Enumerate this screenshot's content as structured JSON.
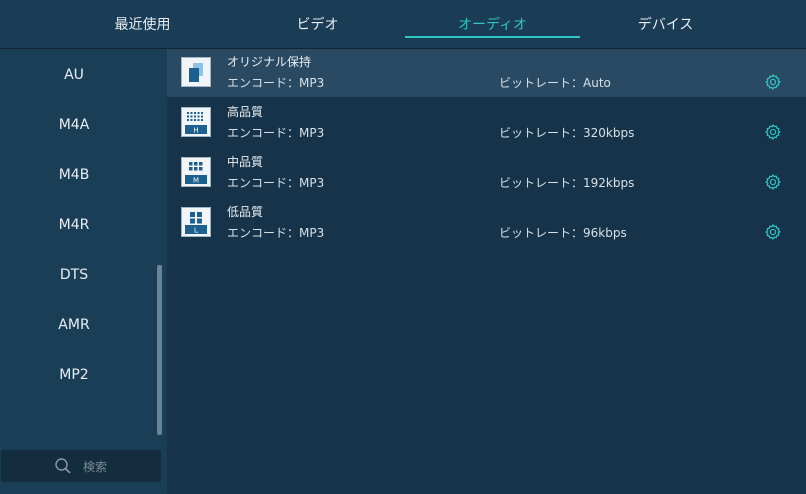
{
  "tabs": [
    {
      "label": "最近使用",
      "active": false
    },
    {
      "label": "ビデオ",
      "active": false
    },
    {
      "label": "オーディオ",
      "active": true
    },
    {
      "label": "デバイス",
      "active": false
    }
  ],
  "sidebar": {
    "items": [
      "AU",
      "M4A",
      "M4B",
      "M4R",
      "DTS",
      "AMR",
      "MP2"
    ],
    "search_placeholder": "検索"
  },
  "presets": [
    {
      "name": "オリジナル保持",
      "encode": "エンコード：MP3",
      "bitrate": "ビットレート：Auto",
      "icon": "original-copy-icon",
      "badge": "",
      "selected": true
    },
    {
      "name": "高品質",
      "encode": "エンコード：MP3",
      "bitrate": "ビットレート：320kbps",
      "icon": "high-quality-icon",
      "badge": "H",
      "selected": false
    },
    {
      "name": "中品質",
      "encode": "エンコード：MP3",
      "bitrate": "ビットレート：192kbps",
      "icon": "medium-quality-icon",
      "badge": "M",
      "selected": false
    },
    {
      "name": "低品質",
      "encode": "エンコード：MP3",
      "bitrate": "ビットレート：96kbps",
      "icon": "low-quality-icon",
      "badge": "L",
      "selected": false
    }
  ],
  "colors": {
    "accent": "#2fc6c6",
    "background": "#163349",
    "sidebar": "#1b3e57",
    "selected_row": "#2a4a63",
    "icon_blue": "#1d5f8f"
  }
}
